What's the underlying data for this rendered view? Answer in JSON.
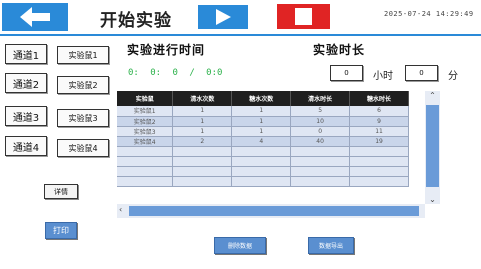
{
  "header": {
    "title": "开始实验",
    "datetime": "2025-07-24 14:29:49",
    "back_icon": "arrow-left-icon",
    "play_icon": "play-icon",
    "stop_icon": "stop-icon"
  },
  "channels": [
    {
      "label": "通道1",
      "mouse": "实验鼠1"
    },
    {
      "label": "通道2",
      "mouse": "实验鼠2"
    },
    {
      "label": "通道3",
      "mouse": "实验鼠3"
    },
    {
      "label": "通道4",
      "mouse": "实验鼠4"
    }
  ],
  "status": {
    "progress_label": "实验进行时间",
    "elapsed": "0: 0: 0  /  0:0",
    "duration_label": "实验时长",
    "hours_value": "0",
    "hours_unit": "小时",
    "minutes_value": "0",
    "minutes_unit": "分"
  },
  "table": {
    "headers": [
      "实验鼠",
      "清水次数",
      "糖水次数",
      "清水时长",
      "糖水时长"
    ],
    "rows": [
      [
        "实验鼠1",
        "1",
        "1",
        "5",
        "6"
      ],
      [
        "实验鼠2",
        "1",
        "1",
        "10",
        "9"
      ],
      [
        "实验鼠3",
        "1",
        "1",
        "0",
        "11"
      ],
      [
        "实验鼠4",
        "2",
        "4",
        "40",
        "19"
      ]
    ]
  },
  "buttons": {
    "detail": "详情",
    "print": "打印",
    "delete_data": "删除数据",
    "export_data": "数据导出"
  },
  "colors": {
    "primary": "#2a8ad8",
    "stop": "#e02424",
    "elapsed_text": "#2bb14a"
  }
}
